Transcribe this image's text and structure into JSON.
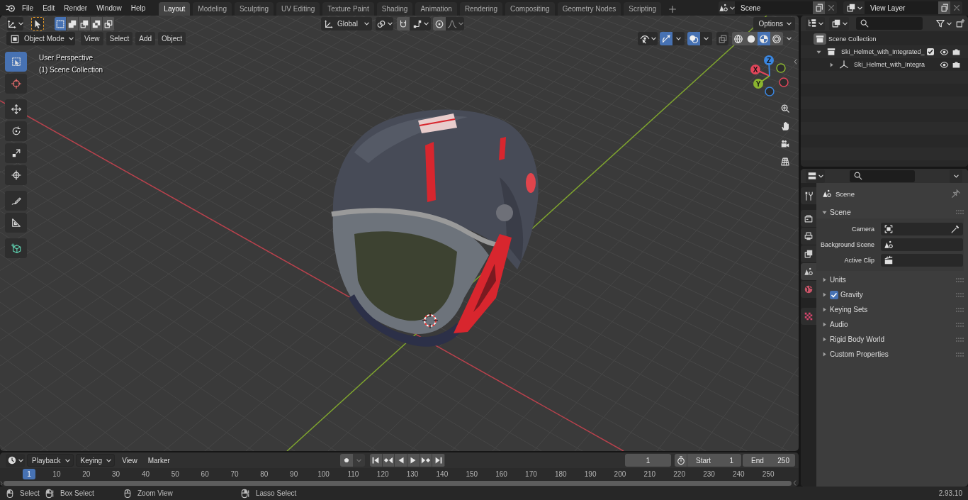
{
  "top_bar": {
    "menus": [
      "File",
      "Edit",
      "Render",
      "Window",
      "Help"
    ],
    "workspace_tabs": [
      {
        "label": "Layout",
        "selected": true
      },
      {
        "label": "Modeling",
        "selected": false
      },
      {
        "label": "Sculpting",
        "selected": false
      },
      {
        "label": "UV Editing",
        "selected": false
      },
      {
        "label": "Texture Paint",
        "selected": false
      },
      {
        "label": "Shading",
        "selected": false
      },
      {
        "label": "Animation",
        "selected": false
      },
      {
        "label": "Rendering",
        "selected": false
      },
      {
        "label": "Compositing",
        "selected": false
      },
      {
        "label": "Geometry Nodes",
        "selected": false
      },
      {
        "label": "Scripting",
        "selected": false
      }
    ],
    "scene": "Scene",
    "view_layer": "View Layer"
  },
  "viewport": {
    "header": {
      "select_modes": [
        {
          "selected": true
        },
        {
          "selected": false
        },
        {
          "selected": false
        },
        {
          "selected": false
        },
        {
          "selected": false
        }
      ],
      "transform_orientation": "Global",
      "options": "Options",
      "mode": "Object Mode",
      "menus": [
        "View",
        "Select",
        "Add",
        "Object"
      ],
      "gizmos": {
        "on": true
      },
      "overlays": {
        "on": true
      },
      "shading_modes": [
        {
          "selected": false
        },
        {
          "selected": false
        },
        {
          "selected": true
        },
        {
          "selected": false
        }
      ]
    },
    "info": [
      "User Perspective",
      "(1) Scene Collection"
    ],
    "tools": [
      {
        "kind": "select-box",
        "selected": true
      },
      {
        "kind": "cursor",
        "selected": false
      },
      {
        "kind": "move",
        "selected": false
      },
      {
        "kind": "rotate",
        "selected": false
      },
      {
        "kind": "scale",
        "selected": false
      },
      {
        "kind": "transform",
        "selected": false
      },
      {
        "kind": "annotate",
        "selected": false
      },
      {
        "kind": "measure",
        "selected": false
      },
      {
        "kind": "add-cube",
        "selected": false
      }
    ],
    "navigation_gizmo": {
      "axes": [
        {
          "label": "X",
          "color": "#e2455a"
        },
        {
          "label": "Y",
          "color": "#8ab42f"
        },
        {
          "label": "Z",
          "color": "#3a86e0"
        }
      ]
    }
  },
  "timeline": {
    "menus": [
      {
        "label": "Playback",
        "kind": "dropdown"
      },
      {
        "label": "Keying",
        "kind": "dropdown"
      },
      {
        "label": "View",
        "kind": "menu"
      },
      {
        "label": "Marker",
        "kind": "menu"
      }
    ],
    "current_frame": "1",
    "start": {
      "label": "Start",
      "value": "1"
    },
    "end": {
      "label": "End",
      "value": "250"
    },
    "playhead": "1",
    "frame_labels": [
      "10",
      "20",
      "30",
      "40",
      "50",
      "60",
      "70",
      "80",
      "90",
      "100",
      "110",
      "120",
      "130",
      "140",
      "150",
      "160",
      "170",
      "180",
      "190",
      "200",
      "210",
      "220",
      "230",
      "240",
      "250"
    ]
  },
  "outliner": {
    "root": {
      "label": "Scene Collection",
      "children": [
        {
          "label": "Ski_Helmet_with_Integrated_",
          "kind": "collection",
          "expanded": true,
          "checkbox": {
            "checked": true
          },
          "children": [
            {
              "label": "Ski_Helmet_with_Integra",
              "kind": "object",
              "expanded": false
            }
          ]
        }
      ]
    }
  },
  "properties": {
    "tabs": [
      {
        "kind": "tool",
        "selected": false
      },
      {
        "kind": "render",
        "selected": false
      },
      {
        "kind": "output",
        "selected": false
      },
      {
        "kind": "view-layer",
        "selected": false
      },
      {
        "kind": "scene",
        "selected": true
      },
      {
        "kind": "world",
        "selected": false
      },
      {
        "kind": "texture",
        "selected": false
      }
    ],
    "context": "Scene",
    "panel": {
      "label": "Scene",
      "expanded": true,
      "fields": [
        {
          "label": "Camera",
          "kind": "camera"
        },
        {
          "label": "Background Scene",
          "kind": "scene"
        },
        {
          "label": "Active Clip",
          "kind": "clip"
        }
      ]
    },
    "subpanels": [
      {
        "label": "Units",
        "expanded": false
      },
      {
        "label": "Gravity",
        "expanded": false,
        "toggle": {
          "checked": true
        }
      },
      {
        "label": "Keying Sets",
        "expanded": false
      },
      {
        "label": "Audio",
        "expanded": false
      },
      {
        "label": "Rigid Body World",
        "expanded": false
      },
      {
        "label": "Custom Properties",
        "expanded": false
      }
    ]
  },
  "status_bar": {
    "hints": [
      {
        "label": "Select",
        "kind": "left"
      },
      {
        "label": "Box Select",
        "kind": "left-drag"
      },
      {
        "label": "Zoom View",
        "kind": "middle"
      },
      {
        "label": "Lasso Select",
        "kind": "right-drag"
      }
    ],
    "version": "2.93.10"
  }
}
